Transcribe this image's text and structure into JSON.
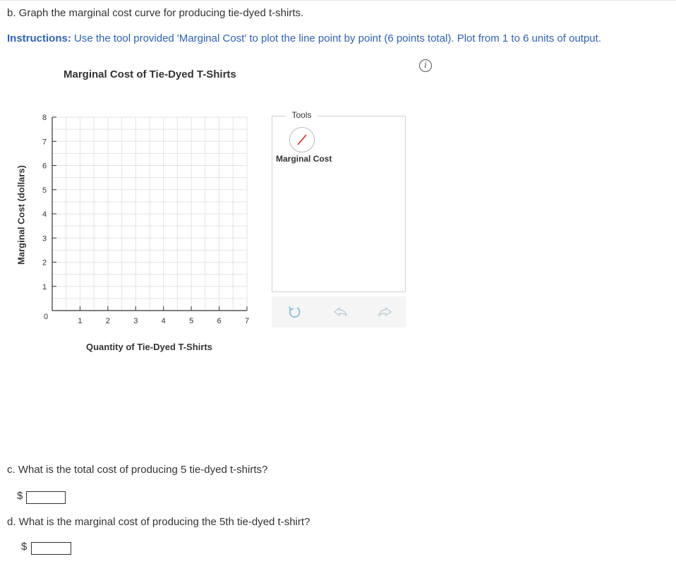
{
  "question_b": "b. Graph the marginal cost curve for producing tie-dyed t-shirts.",
  "instructions_label": "Instructions:",
  "instructions_text": " Use the tool provided 'Marginal Cost' to plot the line point by point (6 points total). Plot from 1 to 6 units of output.",
  "info_icon": "info-icon",
  "chart_data": {
    "type": "line",
    "title": "Marginal Cost of Tie-Dyed T-Shirts",
    "xlabel": "Quantity of Tie-Dyed T-Shirts",
    "ylabel": "Marginal Cost (dollars)",
    "xlim": [
      0,
      7
    ],
    "ylim": [
      0,
      8
    ],
    "x_ticks": [
      1,
      2,
      3,
      4,
      5,
      6,
      7
    ],
    "y_ticks": [
      0,
      1,
      2,
      3,
      4,
      5,
      6,
      7,
      8
    ],
    "grid": true,
    "series": []
  },
  "tools": {
    "title": "Tools",
    "marginal_cost_tool": {
      "label": "Marginal Cost",
      "icon": "line-tool-icon",
      "color": "#e02020"
    },
    "actions": [
      {
        "name": "reset-button",
        "icon": "reset-icon"
      },
      {
        "name": "undo-button",
        "icon": "undo-icon"
      },
      {
        "name": "redo-button",
        "icon": "redo-icon"
      }
    ]
  },
  "question_c": "c. What is the total cost of producing 5 tie-dyed t-shirts?",
  "answer_c": {
    "currency": "$",
    "value": ""
  },
  "question_d": "d. What is the marginal cost of producing the 5th tie-dyed t-shirt?",
  "answer_d": {
    "currency": "$",
    "value": ""
  },
  "colors": {
    "instructions": "#2d62b8",
    "grid": "#e3e3e3",
    "axis": "#333333"
  }
}
